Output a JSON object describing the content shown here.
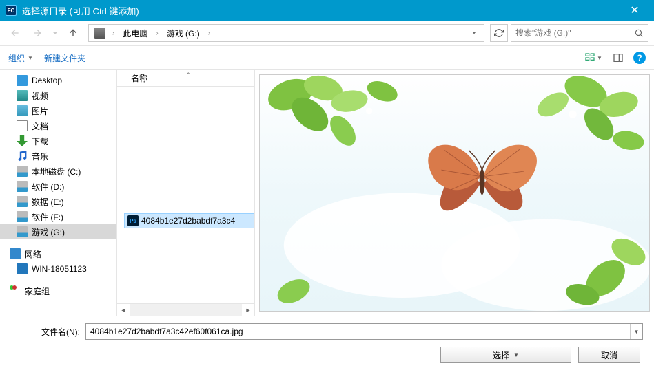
{
  "window": {
    "title": "选择源目录 (可用 Ctrl 键添加)",
    "app_icon_text": "FC"
  },
  "nav": {
    "breadcrumb": [
      "此电脑",
      "游戏 (G:)"
    ],
    "search_placeholder": "搜索\"游戏 (G:)\""
  },
  "toolbar": {
    "organize": "组织",
    "new_folder": "新建文件夹"
  },
  "sidebar": {
    "items": [
      {
        "label": "Desktop",
        "icon": "i-desktop"
      },
      {
        "label": "视频",
        "icon": "i-video"
      },
      {
        "label": "图片",
        "icon": "i-pic"
      },
      {
        "label": "文档",
        "icon": "i-doc"
      },
      {
        "label": "下载",
        "icon": "i-down"
      },
      {
        "label": "音乐",
        "icon": "i-music"
      },
      {
        "label": "本地磁盘 (C:)",
        "icon": "i-disk"
      },
      {
        "label": "软件 (D:)",
        "icon": "i-disk"
      },
      {
        "label": "数据 (E:)",
        "icon": "i-disk"
      },
      {
        "label": "软件 (F:)",
        "icon": "i-disk"
      },
      {
        "label": "游戏 (G:)",
        "icon": "i-disk",
        "selected": true
      }
    ],
    "network_label": "网络",
    "network_child": "WIN-18051123",
    "homegroup_label": "家庭组"
  },
  "filelist": {
    "column_header": "名称",
    "selected_file": "4084b1e27d2babdf7a3c42ef60f061ca.jpg",
    "selected_file_display": "4084b1e27d2babdf7a3c4"
  },
  "bottom": {
    "filename_label": "文件名(N):",
    "filename_value": "4084b1e27d2babdf7a3c42ef60f061ca.jpg",
    "select_button": "选择",
    "cancel_button": "取消"
  }
}
